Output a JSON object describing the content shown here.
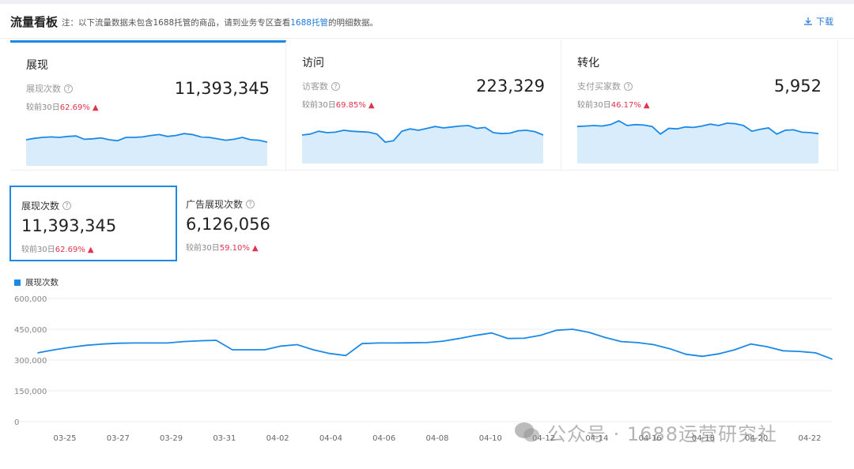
{
  "header": {
    "title": "流量看板",
    "note_prefix": "注：以下流量数据未包含1688托管的商品，请到业务专区查看",
    "note_link": "1688托管",
    "note_suffix": "的明细数据。",
    "download_label": "下载"
  },
  "cards": [
    {
      "title": "展现",
      "label": "展现次数",
      "value": "11,393,345",
      "change_prefix": "较前30日",
      "change": "62.69%",
      "spark": [
        0.55,
        0.58,
        0.6,
        0.61,
        0.6,
        0.62,
        0.63,
        0.56,
        0.57,
        0.59,
        0.55,
        0.53,
        0.6,
        0.6,
        0.61,
        0.64,
        0.66,
        0.62,
        0.64,
        0.68,
        0.66,
        0.61,
        0.6,
        0.57,
        0.54,
        0.56,
        0.6,
        0.55,
        0.54,
        0.5
      ]
    },
    {
      "title": "访问",
      "label": "访客数",
      "value": "223,329",
      "change_prefix": "较前30日",
      "change": "69.85%",
      "spark": [
        0.6,
        0.62,
        0.68,
        0.65,
        0.66,
        0.7,
        0.68,
        0.67,
        0.66,
        0.62,
        0.45,
        0.48,
        0.68,
        0.73,
        0.7,
        0.74,
        0.78,
        0.75,
        0.77,
        0.79,
        0.8,
        0.74,
        0.76,
        0.65,
        0.63,
        0.64,
        0.69,
        0.7,
        0.67,
        0.6
      ]
    },
    {
      "title": "转化",
      "label": "支付买家数",
      "value": "5,952",
      "change_prefix": "较前30日",
      "change": "46.17%",
      "spark": [
        0.78,
        0.79,
        0.8,
        0.79,
        0.82,
        0.9,
        0.8,
        0.82,
        0.81,
        0.78,
        0.62,
        0.74,
        0.73,
        0.77,
        0.76,
        0.79,
        0.83,
        0.8,
        0.85,
        0.84,
        0.8,
        0.68,
        0.72,
        0.75,
        0.62,
        0.7,
        0.71,
        0.66,
        0.65,
        0.63
      ]
    }
  ],
  "metrics": [
    {
      "label": "展现次数",
      "value": "11,393,345",
      "change_prefix": "较前30日",
      "change": "62.69%"
    },
    {
      "label": "广告展现次数",
      "value": "6,126,056",
      "change_prefix": "较前30日",
      "change": "59.10%"
    }
  ],
  "legend_label": "展现次数",
  "colors": {
    "accent": "#1a8ae6",
    "up": "#e0334d",
    "fill": "#d9ecfc"
  },
  "chart_data": {
    "type": "line",
    "series": [
      {
        "name": "展现次数",
        "values": [
          335000,
          350000,
          362000,
          372000,
          378000,
          382000,
          383000,
          383000,
          383000,
          390000,
          394000,
          396000,
          350000,
          350000,
          350000,
          368000,
          375000,
          350000,
          332000,
          322000,
          380000,
          383000,
          383000,
          384000,
          385000,
          392000,
          405000,
          420000,
          432000,
          405000,
          406000,
          420000,
          445000,
          450000,
          435000,
          410000,
          390000,
          385000,
          375000,
          355000,
          328000,
          318000,
          330000,
          350000,
          378000,
          365000,
          345000,
          342000,
          335000,
          305000
        ]
      }
    ],
    "xticks": [
      "03-25",
      "03-27",
      "03-29",
      "03-31",
      "04-02",
      "04-04",
      "04-06",
      "04-08",
      "04-10",
      "04-12",
      "04-14",
      "04-16",
      "04-18",
      "04-20",
      "04-22"
    ],
    "yticks": [
      "600,000",
      "450,000",
      "300,000",
      "150,000",
      "0"
    ],
    "ylim": [
      0,
      600000
    ]
  },
  "watermark": {
    "text": "公众号 · 1688运营研究社",
    "icon": "wechat-icon"
  }
}
